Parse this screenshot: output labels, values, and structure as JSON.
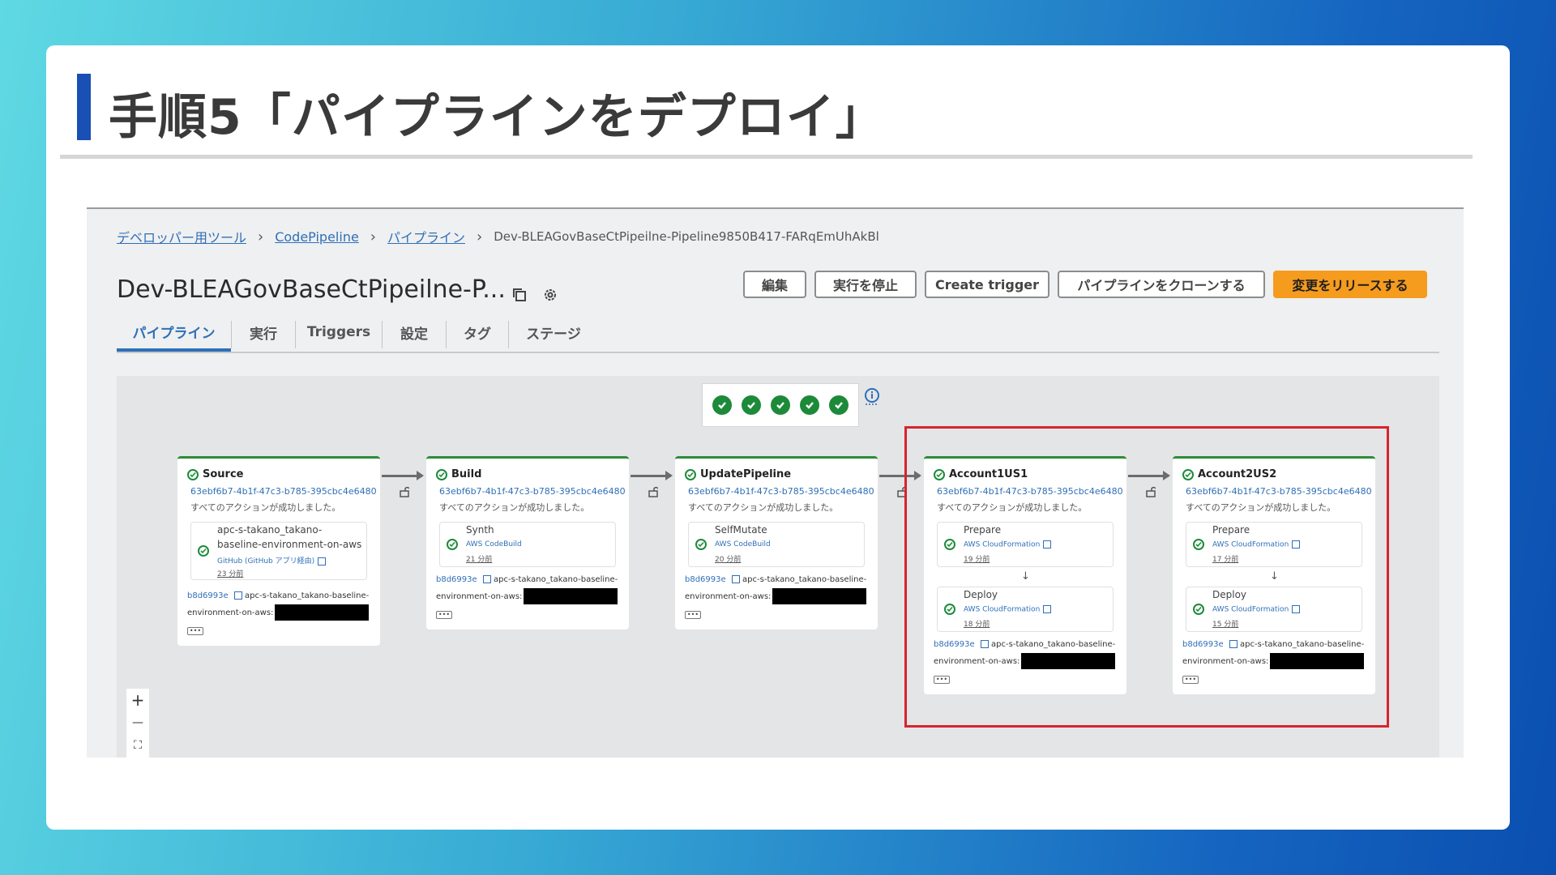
{
  "slide": {
    "title": "手順5「パイプラインをデプロイ」"
  },
  "breadcrumb": {
    "items": [
      "デベロッパー用ツール",
      "CodePipeline",
      "パイプライン"
    ],
    "current": "Dev-BLEAGovBaseCtPipeilne-Pipeline9850B417-FARqEmUhAkBl"
  },
  "page": {
    "title": "Dev-BLEAGovBaseCtPipeilne-P..."
  },
  "buttons": {
    "edit": "編集",
    "stop": "実行を停止",
    "trigger": "Create trigger",
    "clone": "パイプラインをクローンする",
    "release": "変更をリリースする"
  },
  "tabs": [
    "パイプライン",
    "実行",
    "Triggers",
    "設定",
    "タグ",
    "ステージ"
  ],
  "colors": {
    "accent": "#2f6fb7",
    "success": "#1d8a3a",
    "primary_button": "#f59b1e",
    "highlight": "#d9232f"
  },
  "status_checks": 5,
  "stages": [
    {
      "name": "Source",
      "hash": "63ebf6b7-4b1f-47c3-b785-395cbc4e6480",
      "message": "すべてのアクションが成功しました。",
      "actions": [
        {
          "name_line1": "apc-s-takano_takano-",
          "name_line2": "baseline-environment-on-aws",
          "provider": "GitHub (GitHub アプリ経由)",
          "time": "23 分前"
        }
      ],
      "commit_hash": "b8d6993e",
      "commit_line1": "apc-s-takano_takano-baseline-",
      "commit_line2": "environment-on-aws:"
    },
    {
      "name": "Build",
      "hash": "63ebf6b7-4b1f-47c3-b785-395cbc4e6480",
      "message": "すべてのアクションが成功しました。",
      "actions": [
        {
          "name": "Synth",
          "provider": "AWS CodeBuild",
          "time": "21 分前"
        }
      ],
      "commit_hash": "b8d6993e",
      "commit_line1": "apc-s-takano_takano-baseline-",
      "commit_line2": "environment-on-aws:"
    },
    {
      "name": "UpdatePipeline",
      "hash": "63ebf6b7-4b1f-47c3-b785-395cbc4e6480",
      "message": "すべてのアクションが成功しました。",
      "actions": [
        {
          "name": "SelfMutate",
          "provider": "AWS CodeBuild",
          "time": "20 分前"
        }
      ],
      "commit_hash": "b8d6993e",
      "commit_line1": "apc-s-takano_takano-baseline-",
      "commit_line2": "environment-on-aws:"
    },
    {
      "name": "Account1US1",
      "hash": "63ebf6b7-4b1f-47c3-b785-395cbc4e6480",
      "message": "すべてのアクションが成功しました。",
      "actions": [
        {
          "name": "Prepare",
          "provider": "AWS CloudFormation",
          "time": "19 分前"
        },
        {
          "name": "Deploy",
          "provider": "AWS CloudFormation",
          "time": "18 分前"
        }
      ],
      "commit_hash": "b8d6993e",
      "commit_line1": "apc-s-takano_takano-baseline-",
      "commit_line2": "environment-on-aws:"
    },
    {
      "name": "Account2US2",
      "hash": "63ebf6b7-4b1f-47c3-b785-395cbc4e6480",
      "message": "すべてのアクションが成功しました。",
      "actions": [
        {
          "name": "Prepare",
          "provider": "AWS CloudFormation",
          "time": "17 分前"
        },
        {
          "name": "Deploy",
          "provider": "AWS CloudFormation",
          "time": "15 分前"
        }
      ],
      "commit_hash": "b8d6993e",
      "commit_line1": "apc-s-takano_takano-baseline-",
      "commit_line2": "environment-on-aws:"
    }
  ],
  "zoom_controls": {
    "zoom_in": "+",
    "zoom_out": "—",
    "fit": "⛶"
  },
  "more_label": "•••",
  "arrow_down": "↓"
}
